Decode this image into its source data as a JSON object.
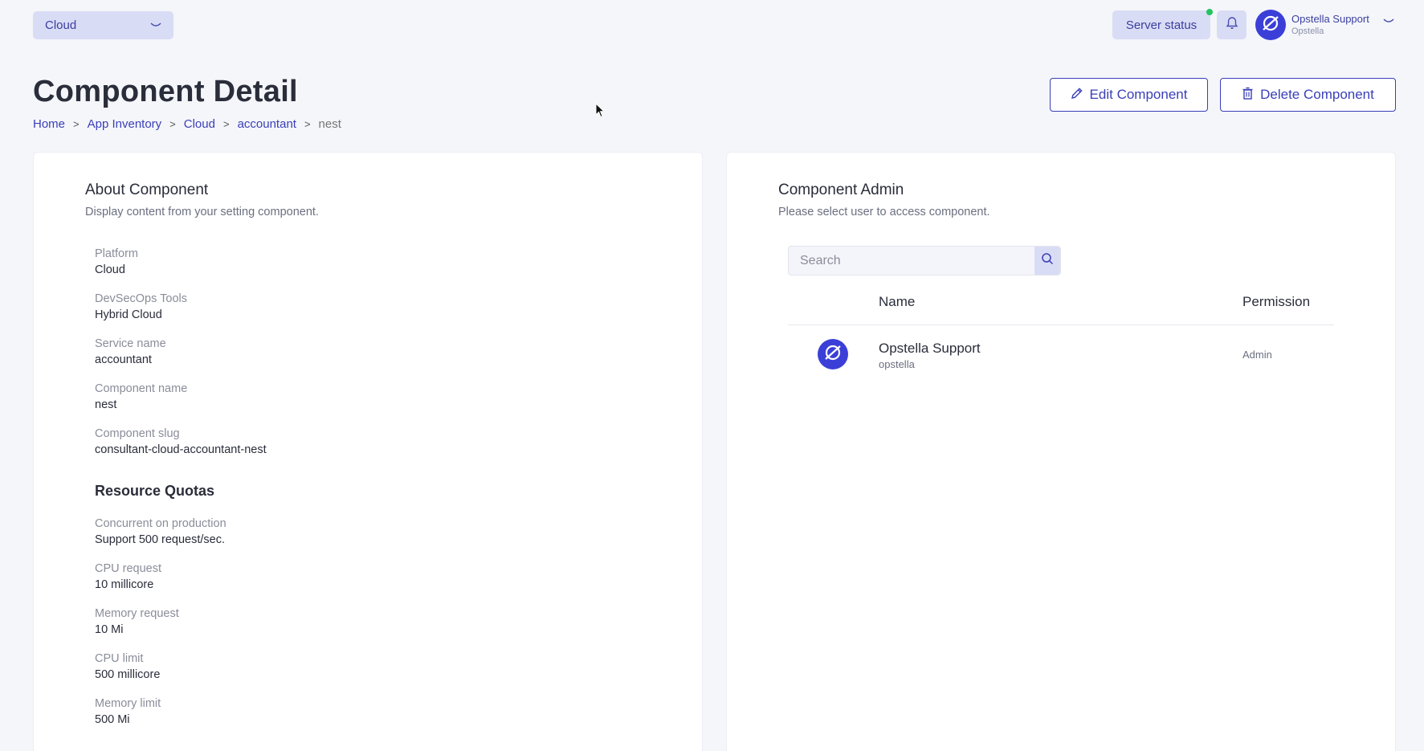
{
  "topbar": {
    "platform_select": "Cloud",
    "server_status": "Server status",
    "user_name": "Opstella Support",
    "user_org": "Opstella"
  },
  "header": {
    "title": "Component Detail",
    "breadcrumb": [
      "Home",
      "App Inventory",
      "Cloud",
      "accountant",
      "nest"
    ],
    "edit_button": "Edit Component",
    "delete_button": "Delete Component"
  },
  "about": {
    "title": "About Component",
    "subtitle": "Display content from your setting component.",
    "fields": [
      {
        "label": "Platform",
        "value": "Cloud"
      },
      {
        "label": "DevSecOps Tools",
        "value": "Hybrid Cloud"
      },
      {
        "label": "Service name",
        "value": "accountant"
      },
      {
        "label": "Component name",
        "value": "nest"
      },
      {
        "label": "Component slug",
        "value": "consultant-cloud-accountant-nest"
      }
    ],
    "quotas_title": "Resource Quotas",
    "quotas": [
      {
        "label": "Concurrent on production",
        "value": "Support 500 request/sec."
      },
      {
        "label": "CPU request",
        "value": "10 millicore"
      },
      {
        "label": "Memory request",
        "value": "10 Mi"
      },
      {
        "label": "CPU limit",
        "value": "500 millicore"
      },
      {
        "label": "Memory limit",
        "value": "500 Mi"
      }
    ]
  },
  "admin": {
    "title": "Component Admin",
    "subtitle": "Please select user to access component.",
    "search_placeholder": "Search",
    "columns": {
      "name": "Name",
      "permission": "Permission"
    },
    "rows": [
      {
        "name": "Opstella Support",
        "username": "opstella",
        "permission": "Admin"
      }
    ]
  },
  "colors": {
    "accent": "#3a3fb8",
    "avatar": "#3b3fd8",
    "status_online": "#22c55e"
  },
  "icons": [
    "chevron-down-icon",
    "bell-icon",
    "opstella-logo-icon",
    "pencil-icon",
    "trash-icon",
    "search-icon",
    "cursor-icon"
  ]
}
